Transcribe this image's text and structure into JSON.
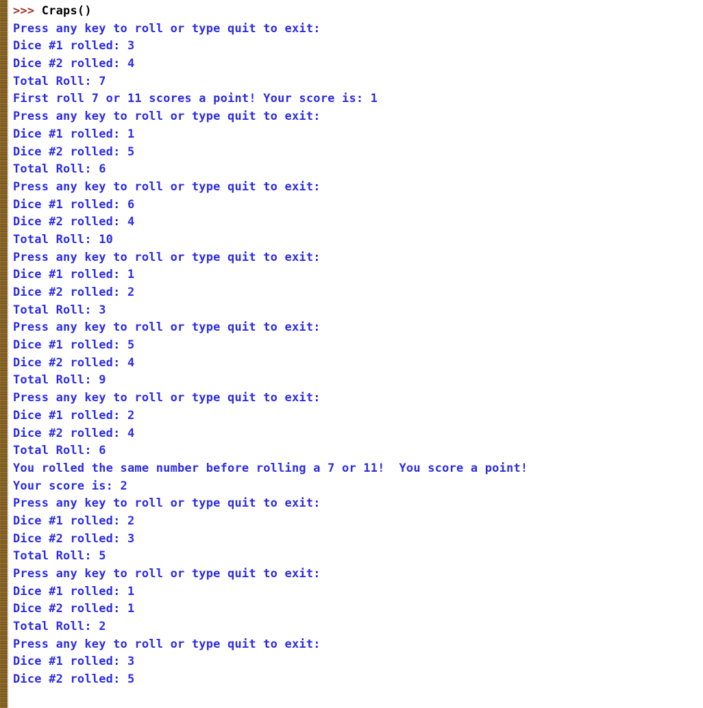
{
  "window": {
    "title": "Python Shell",
    "prompt_symbol": ">>>",
    "command": "Craps()"
  },
  "theme": {
    "background": "#ffffff",
    "output_text": "#2b2be6",
    "prompt_marker": "#a03024",
    "command_text": "#000000",
    "border_strip": "#c3a46e"
  },
  "console": {
    "lines": [
      {
        "type": "prompt",
        "marker": ">>>",
        "text": " Craps()"
      },
      {
        "type": "output",
        "text": "Press any key to roll or type quit to exit:"
      },
      {
        "type": "output",
        "text": "Dice #1 rolled: 3"
      },
      {
        "type": "output",
        "text": "Dice #2 rolled: 4"
      },
      {
        "type": "output",
        "text": "Total Roll: 7"
      },
      {
        "type": "output",
        "text": "First roll 7 or 11 scores a point! Your score is: 1"
      },
      {
        "type": "output",
        "text": "Press any key to roll or type quit to exit:"
      },
      {
        "type": "output",
        "text": "Dice #1 rolled: 1"
      },
      {
        "type": "output",
        "text": "Dice #2 rolled: 5"
      },
      {
        "type": "output",
        "text": "Total Roll: 6"
      },
      {
        "type": "output",
        "text": "Press any key to roll or type quit to exit:"
      },
      {
        "type": "output",
        "text": "Dice #1 rolled: 6"
      },
      {
        "type": "output",
        "text": "Dice #2 rolled: 4"
      },
      {
        "type": "output",
        "text": "Total Roll: 10"
      },
      {
        "type": "output",
        "text": "Press any key to roll or type quit to exit:"
      },
      {
        "type": "output",
        "text": "Dice #1 rolled: 1"
      },
      {
        "type": "output",
        "text": "Dice #2 rolled: 2"
      },
      {
        "type": "output",
        "text": "Total Roll: 3"
      },
      {
        "type": "output",
        "text": "Press any key to roll or type quit to exit:"
      },
      {
        "type": "output",
        "text": "Dice #1 rolled: 5"
      },
      {
        "type": "output",
        "text": "Dice #2 rolled: 4"
      },
      {
        "type": "output",
        "text": "Total Roll: 9"
      },
      {
        "type": "output",
        "text": "Press any key to roll or type quit to exit:"
      },
      {
        "type": "output",
        "text": "Dice #1 rolled: 2"
      },
      {
        "type": "output",
        "text": "Dice #2 rolled: 4"
      },
      {
        "type": "output",
        "text": "Total Roll: 6"
      },
      {
        "type": "output",
        "text": "You rolled the same number before rolling a 7 or 11!  You score a point!"
      },
      {
        "type": "output",
        "text": "Your score is: 2"
      },
      {
        "type": "output",
        "text": "Press any key to roll or type quit to exit:"
      },
      {
        "type": "output",
        "text": "Dice #1 rolled: 2"
      },
      {
        "type": "output",
        "text": "Dice #2 rolled: 3"
      },
      {
        "type": "output",
        "text": "Total Roll: 5"
      },
      {
        "type": "output",
        "text": "Press any key to roll or type quit to exit:"
      },
      {
        "type": "output",
        "text": "Dice #1 rolled: 1"
      },
      {
        "type": "output",
        "text": "Dice #2 rolled: 1"
      },
      {
        "type": "output",
        "text": "Total Roll: 2"
      },
      {
        "type": "output",
        "text": "Press any key to roll or type quit to exit:"
      },
      {
        "type": "output",
        "text": "Dice #1 rolled: 3"
      },
      {
        "type": "output",
        "text": "Dice #2 rolled: 5"
      }
    ]
  }
}
